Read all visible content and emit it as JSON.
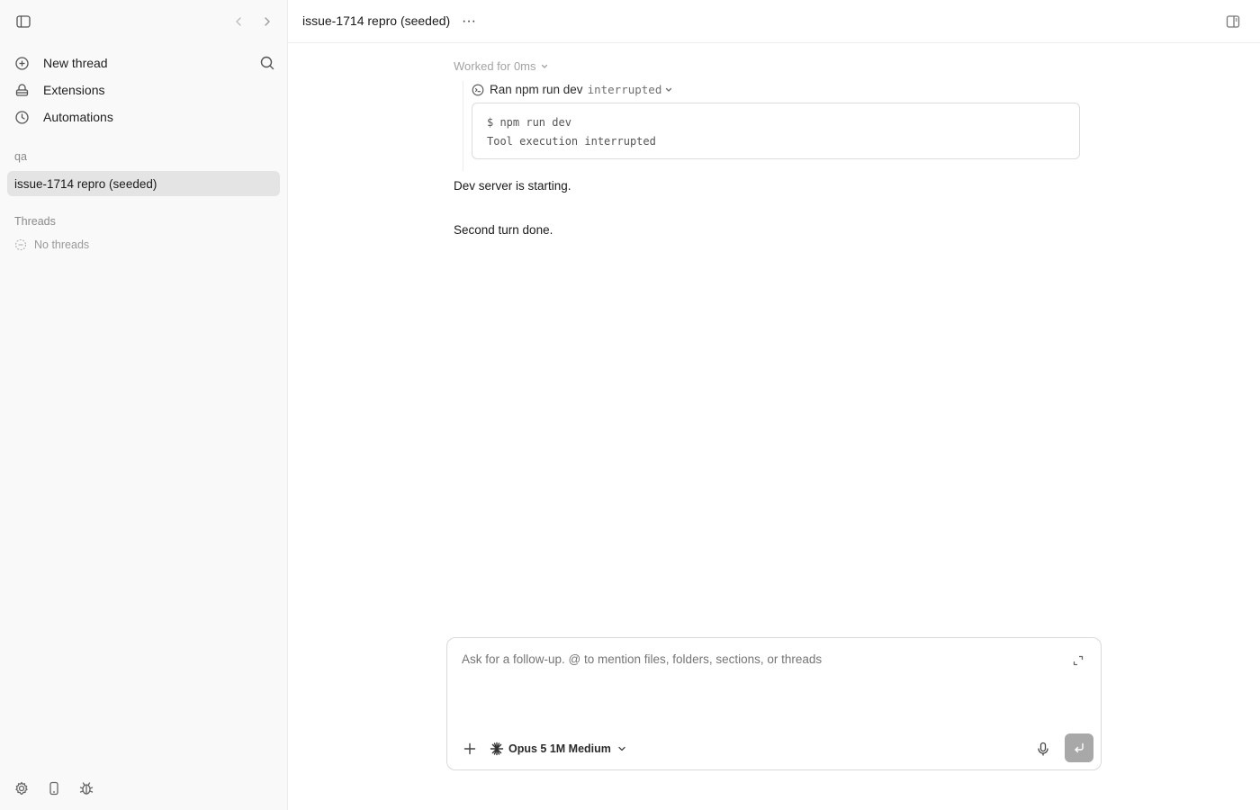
{
  "sidebar": {
    "menu": {
      "new_thread": "New thread",
      "extensions": "Extensions",
      "automations": "Automations"
    },
    "project_section_label": "qa",
    "active_project": "issue-1714 repro (seeded)",
    "threads_section_label": "Threads",
    "no_threads_text": "No threads"
  },
  "header": {
    "title": "issue-1714 repro (seeded)",
    "more_label": "···"
  },
  "conversation": {
    "worked_label": "Worked for 0ms",
    "tool": {
      "label": "Ran npm run dev",
      "status": "interrupted",
      "command": "$ npm run dev",
      "output": "Tool execution interrupted"
    },
    "messages": [
      "Dev server is starting.",
      "Second turn done."
    ]
  },
  "composer": {
    "placeholder": "Ask for a follow-up. @ to mention files, folders, sections, or threads",
    "model": "Opus 5 1M Medium"
  },
  "icons": {
    "sidebar_toggle": "sidebar-toggle-icon",
    "back": "chevron-left-icon",
    "forward": "chevron-right-icon",
    "new_thread": "plus-circle-icon",
    "search": "search-icon",
    "extensions": "extensions-icon",
    "automations": "clock-icon",
    "no_threads": "dashed-circle-icon",
    "settings": "gear-icon",
    "mobile": "phone-icon",
    "debug": "bug-icon",
    "panel": "panel-icon",
    "expand": "expand-icon",
    "add": "plus-icon",
    "model": "sparkle-icon",
    "mic": "mic-icon",
    "send": "send-icon"
  }
}
